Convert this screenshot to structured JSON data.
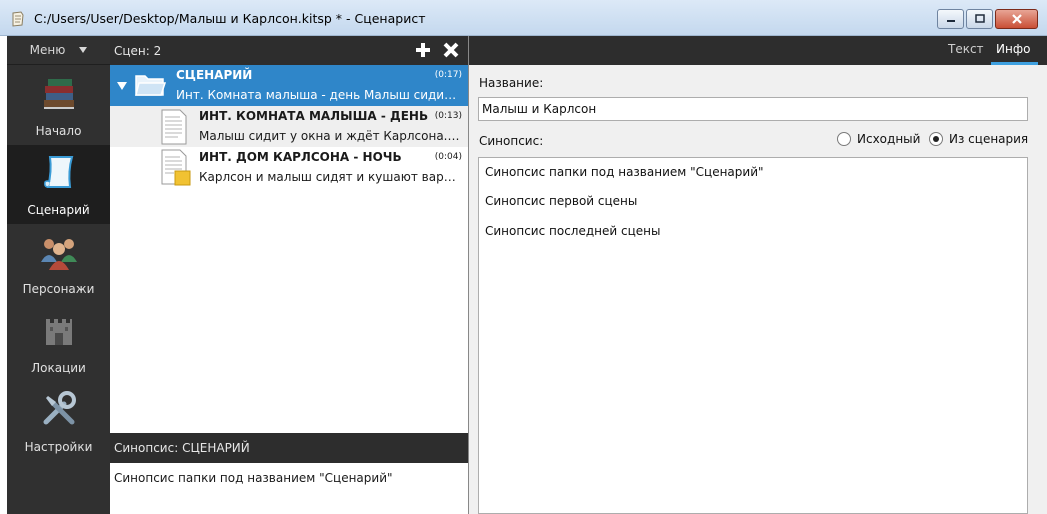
{
  "window": {
    "title": "C:/Users/User/Desktop/Малыш и Карлсон.kitsp * - Сценарист"
  },
  "nav": {
    "menu_label": "Меню",
    "items": [
      {
        "label": "Начало",
        "icon": "books-icon"
      },
      {
        "label": "Сценарий",
        "icon": "scroll-icon"
      },
      {
        "label": "Персонажи",
        "icon": "people-icon"
      },
      {
        "label": "Локации",
        "icon": "castle-icon"
      },
      {
        "label": "Настройки",
        "icon": "tools-icon"
      }
    ]
  },
  "scenes": {
    "count_label": "Сцен:",
    "count": "2",
    "folder": {
      "title": "СЦЕНАРИЙ",
      "time": "(0:17)",
      "desc": "Инт. Комната малыша - день Малыш сидит у ок..."
    },
    "items": [
      {
        "title": "ИНТ. КОМНАТА МАЛЫША - ДЕНЬ",
        "time": "(0:13)",
        "desc": "Малыш сидит у окна и ждёт Карлсона. Карл..."
      },
      {
        "title": "ИНТ. ДОМ КАРЛСОНА - НОЧЬ",
        "time": "(0:04)",
        "desc": "Карлсон и малыш сидят и кушают варенье. ..."
      }
    ],
    "synopsis_header": "Синопсис: СЦЕНАРИЙ",
    "synopsis_text": "Синопсис папки под названием \"Сценарий\""
  },
  "details": {
    "tabs": [
      "Текст",
      "Инфо"
    ],
    "active_tab": "Инфо",
    "name_label": "Название:",
    "name_value": "Малыш и Карлсон",
    "synopsis_label": "Синопсис:",
    "radio_source": "Исходный",
    "radio_from_script": "Из сценария",
    "selected_radio": "Из сценария",
    "synopsis_lines": [
      "Синопсис папки под названием \"Сценарий\"",
      "Синопсис первой сцены",
      "Синопсис последней сцены"
    ]
  },
  "colors": {
    "accent": "#2f86c9",
    "dark_panel": "#2d2d2d",
    "nav_bg": "#303030",
    "tab_underline": "#3ea0e0"
  }
}
